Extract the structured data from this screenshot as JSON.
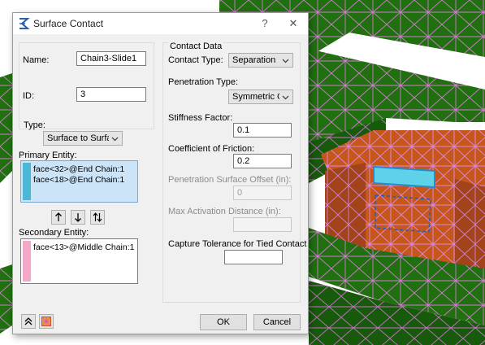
{
  "dialog": {
    "title": "Surface Contact",
    "help_label": "?",
    "close_label": "✕",
    "name_label": "Name:",
    "name_value": "Chain3-Slide1",
    "id_label": "ID:",
    "id_value": "3",
    "type_label": "Type:",
    "type_value": "Surface to Surface",
    "primary_label": "Primary Entity:",
    "primary_items": [
      "face<32>@End Chain:1",
      "face<18>@End Chain:1"
    ],
    "secondary_label": "Secondary Entity:",
    "secondary_items": [
      "face<13>@Middle Chain:1"
    ],
    "contact_data_label": "Contact Data",
    "contact_type_label": "Contact Type:",
    "contact_type_value": "Separation",
    "penetration_type_label": "Penetration Type:",
    "penetration_type_value": "Symmetric Conta",
    "stiffness_label": "Stiffness Factor:",
    "stiffness_value": "0.1",
    "friction_label": "Coefficient of Friction:",
    "friction_value": "0.2",
    "pen_offset_label": "Penetration Surface Offset (in):",
    "pen_offset_value": "0",
    "max_activation_label": "Max Activation Distance (in):",
    "max_activation_value": "",
    "capture_label": "Capture Tolerance for Tied Contact",
    "capture_value": "",
    "ok_label": "OK",
    "cancel_label": "Cancel"
  },
  "colors": {
    "primary_swatch": "#4db8d6",
    "secondary_swatch": "#f3a7c9",
    "primary_list_bg": "#cce4f7",
    "mesh_green": "#1f6f10",
    "mesh_orange": "#c8561a",
    "mesh_edge": "#d07ad0"
  },
  "icons": {
    "title": "surface-contact-icon",
    "move_up": "arrow-up-icon",
    "move_down": "arrow-down-icon",
    "swap": "swap-arrows-icon",
    "collapse": "double-chevron-up-icon",
    "pick": "mesh-pick-icon"
  }
}
